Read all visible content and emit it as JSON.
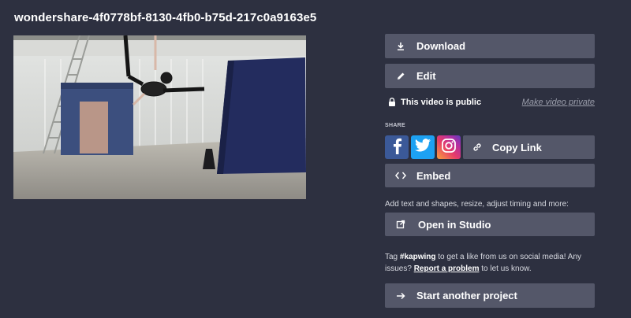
{
  "title": "wondershare-4f0778bf-8130-4fb0-b75d-217c0a9163e5",
  "video": {
    "icon": "video-thumbnail"
  },
  "actions": {
    "download_label": "Download",
    "edit_label": "Edit",
    "public_label": "This video is public",
    "make_private_label": "Make video private",
    "share_heading": "SHARE",
    "copy_link_label": "Copy Link",
    "embed_label": "Embed",
    "studio_hint": "Add text and shapes, resize, adjust timing and more:",
    "open_studio_label": "Open in Studio",
    "tag_pre": "Tag ",
    "tag_hashtag": "#kapwing",
    "tag_mid": " to get a like from us on social media! Any issues? ",
    "report_link": "Report a problem",
    "tag_post": " to let us know.",
    "start_label": "Start another project"
  },
  "colors": {
    "background": "#2d3040",
    "button": "#545769",
    "facebook": "#3b5998",
    "twitter": "#1da1f2"
  }
}
